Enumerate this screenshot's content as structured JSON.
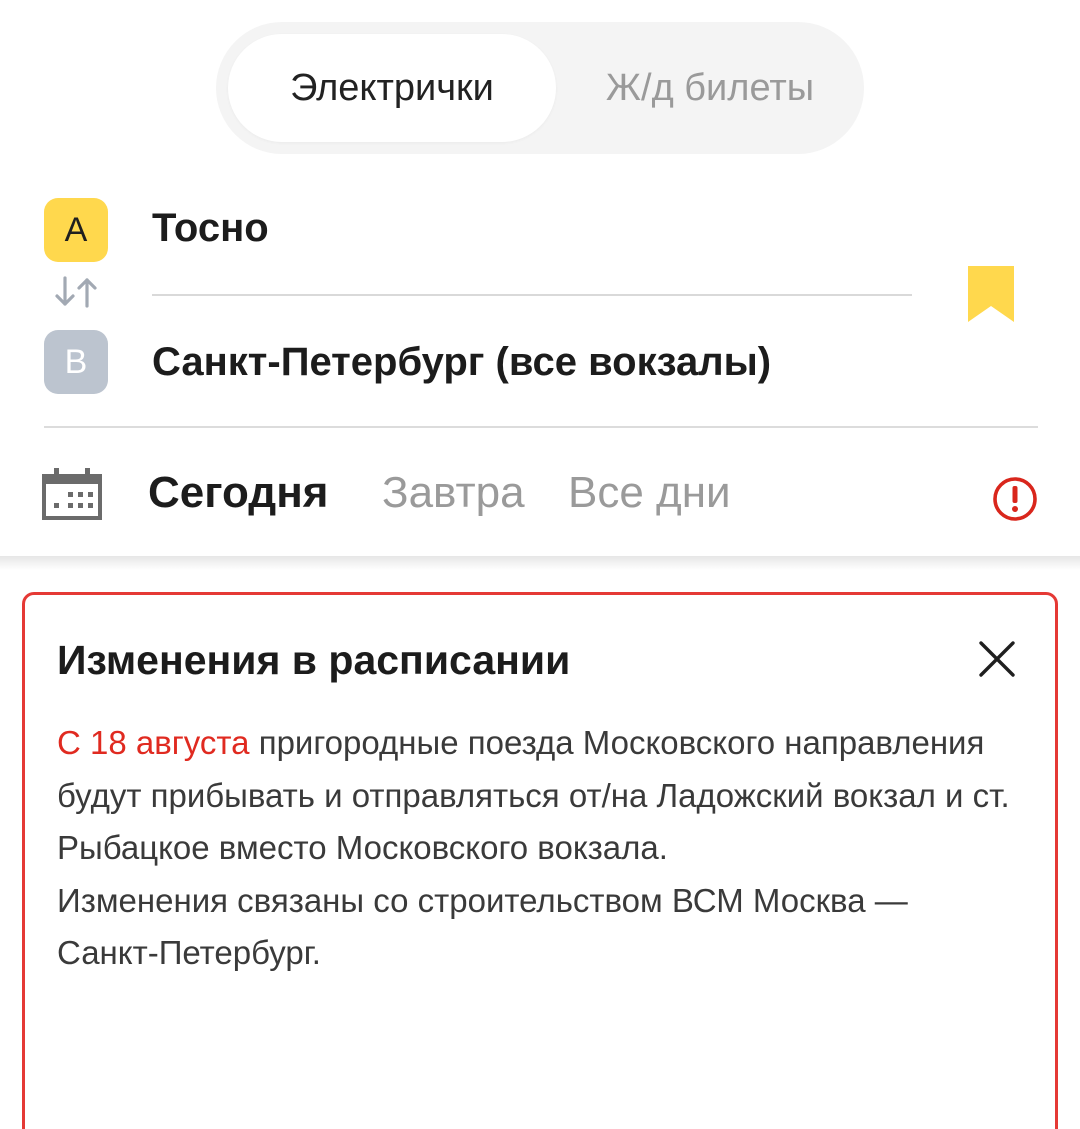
{
  "tabs": {
    "active": "Электрички",
    "inactive": "Ж/д билеты"
  },
  "route": {
    "from_badge": "A",
    "from": "Тосно",
    "to_badge": "B",
    "to": "Санкт-Петербург (все вокзалы)"
  },
  "dates": {
    "today": "Сегодня",
    "tomorrow": "Завтра",
    "all_days": "Все дни"
  },
  "notice": {
    "title": "Изменения в расписании",
    "highlight": "С 18 августа",
    "body_part1": " пригородные поезда Московского направления будут прибывать и отправляться от/на Ладожский вокзал и ст. Рыбацкое вместо Московского вокзала.",
    "body_part2": "Изменения связаны со строительством ВСМ Москва — Санкт-Петербург."
  },
  "colors": {
    "accent_yellow": "#ffd84d",
    "alert_red": "#e53935",
    "muted_gray": "#9a9a9a"
  },
  "icons": [
    "swap-icon",
    "bookmark-icon",
    "calendar-icon",
    "alert-icon",
    "close-icon"
  ]
}
